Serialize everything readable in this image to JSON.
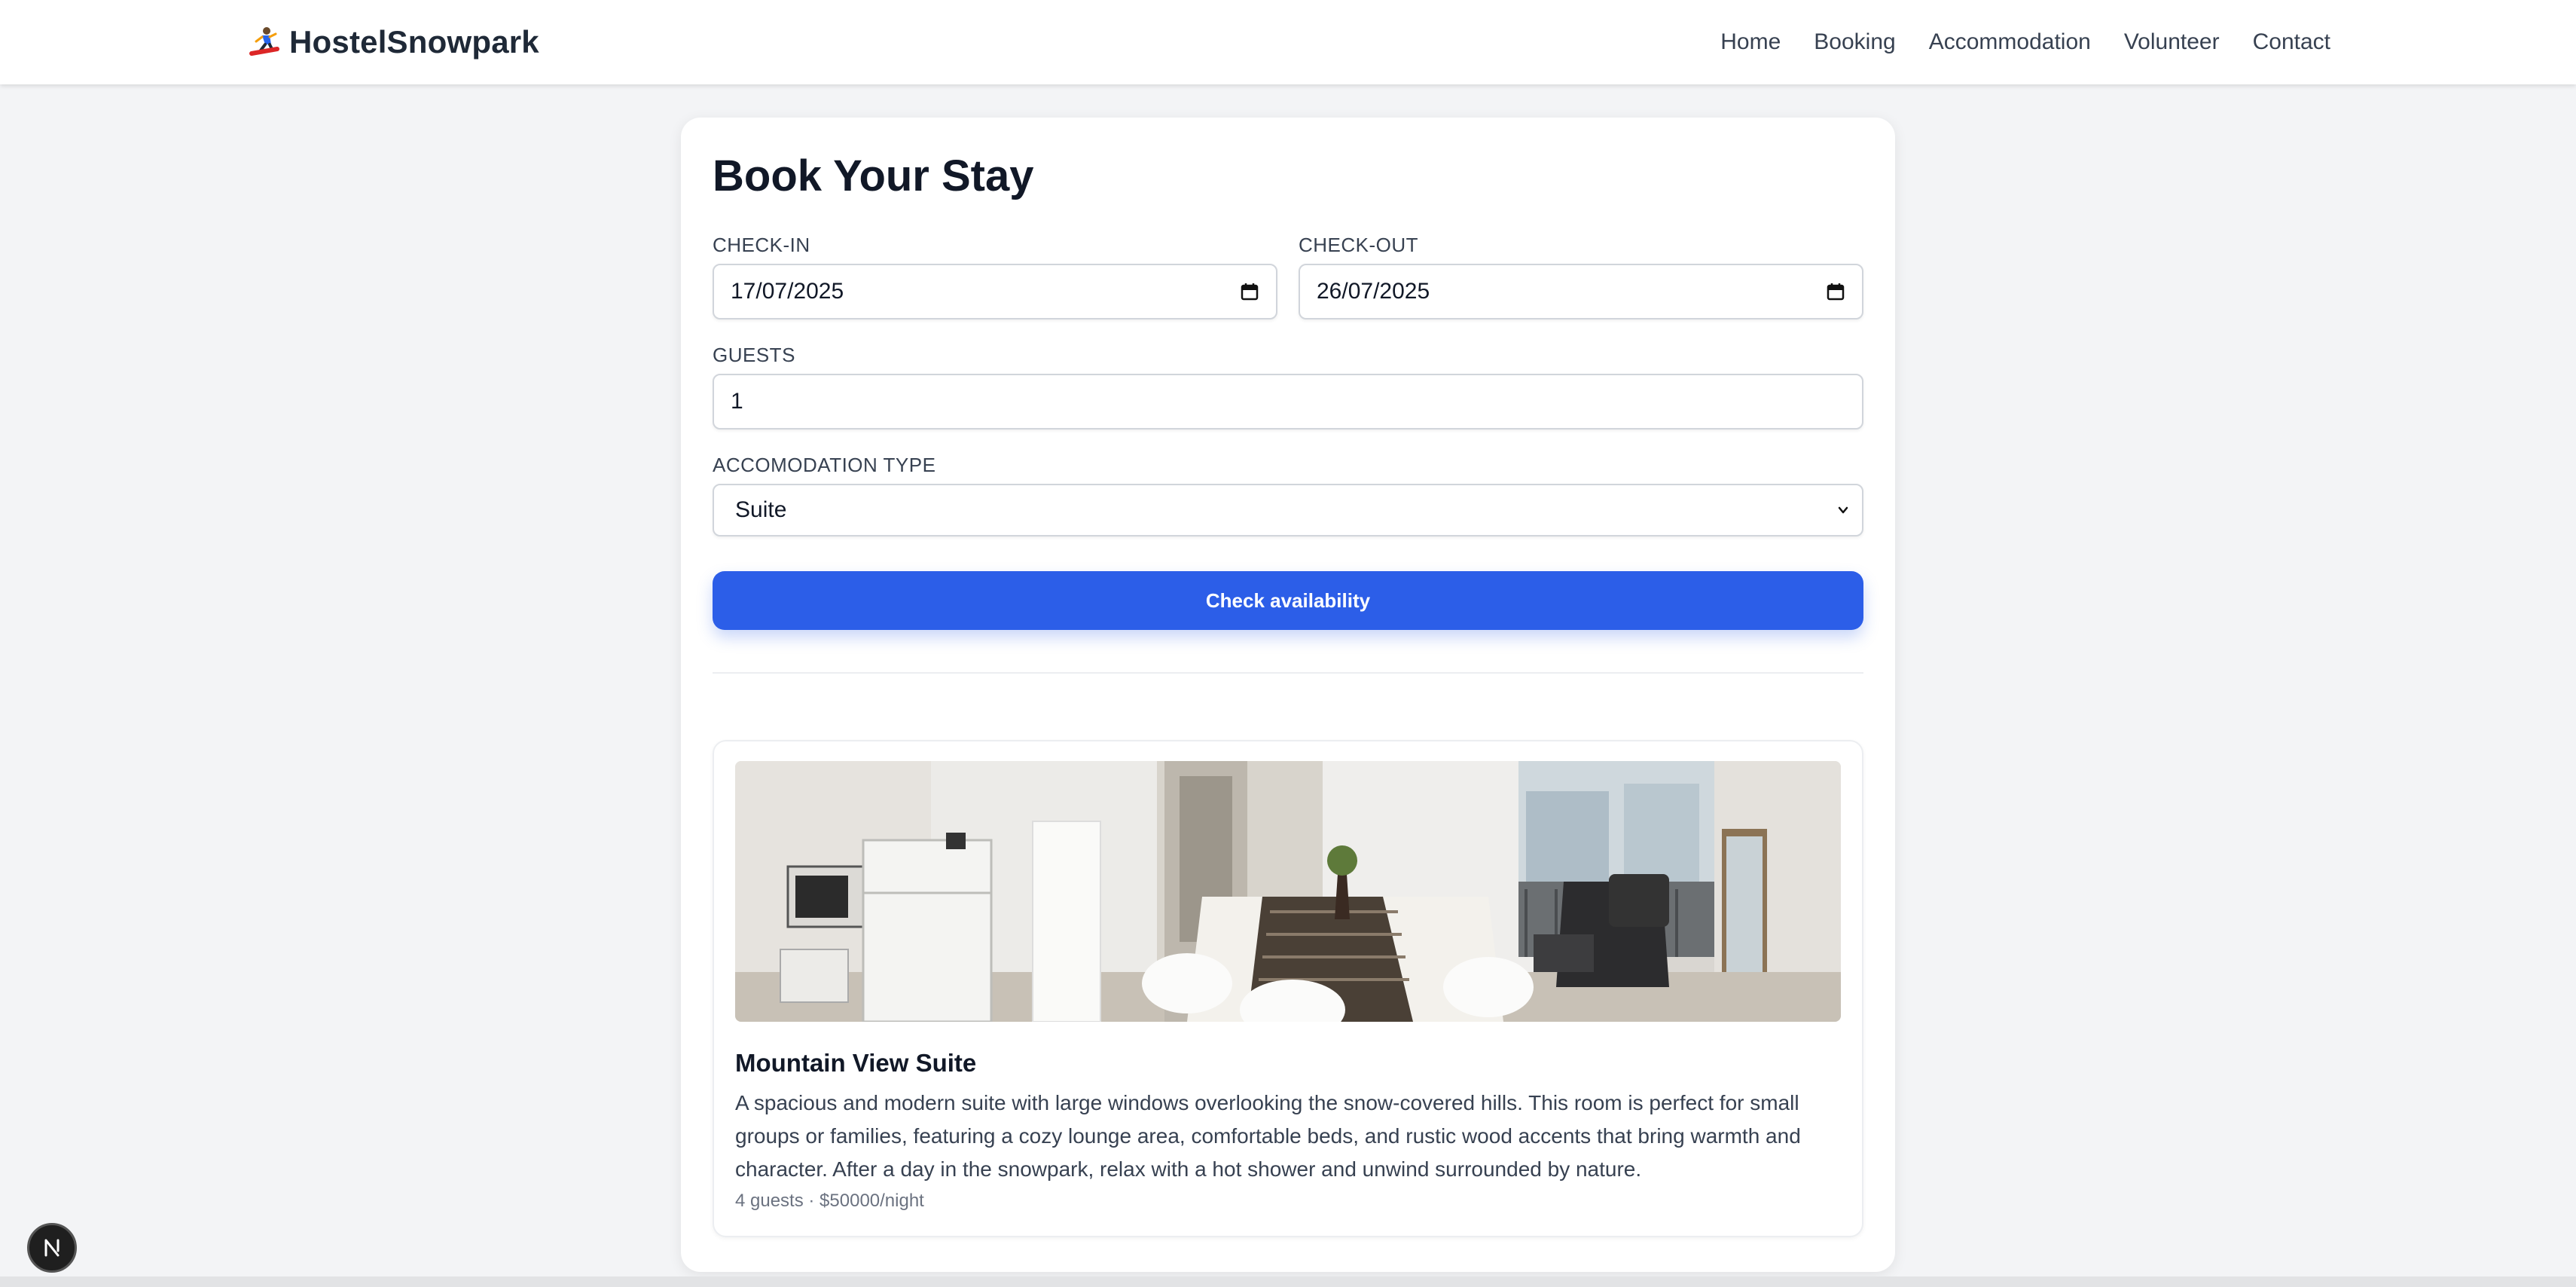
{
  "nav": {
    "brand": "HostelSnowpark",
    "brand_icon": "snowboarder-icon",
    "links": [
      "Home",
      "Booking",
      "Accommodation",
      "Volunteer",
      "Contact"
    ]
  },
  "booking": {
    "title": "Book Your Stay",
    "checkin_label": "CHECK-IN",
    "checkin_value": "17/07/2025",
    "checkout_label": "CHECK-OUT",
    "checkout_value": "26/07/2025",
    "guests_label": "GUESTS",
    "guests_value": "1",
    "type_label": "ACCOMODATION TYPE",
    "type_value": "Suite",
    "submit_label": "Check availability"
  },
  "room": {
    "title": "Mountain View Suite",
    "description": "A spacious and modern suite with large windows overlooking the snow-covered hills. This room is perfect for small groups or families, featuring a cozy lounge area, comfortable beds, and rustic wood accents that bring warmth and character. After a day in the snowpark, relax with a hot shower and unwind surrounded by nature.",
    "meta": "4 guests · $50000/night"
  },
  "colors": {
    "accent": "#2c5ee8",
    "background": "#f3f4f6"
  }
}
